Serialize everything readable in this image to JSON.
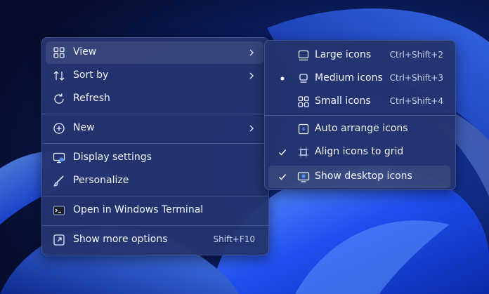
{
  "context_menu": {
    "items": [
      {
        "label": "View",
        "icon": "view-grid-icon",
        "submenu": true
      },
      {
        "label": "Sort by",
        "icon": "sort-icon",
        "submenu": true
      },
      {
        "label": "Refresh",
        "icon": "refresh-icon"
      },
      {
        "label": "New",
        "icon": "new-plus-icon",
        "submenu": true
      },
      {
        "label": "Display settings",
        "icon": "display-settings-icon"
      },
      {
        "label": "Personalize",
        "icon": "personalize-brush-icon"
      },
      {
        "label": "Open in Windows Terminal",
        "icon": "terminal-icon"
      },
      {
        "label": "Show more options",
        "icon": "show-more-options-icon",
        "shortcut": "Shift+F10"
      }
    ]
  },
  "view_submenu": {
    "items": [
      {
        "label": "Large icons",
        "icon": "large-icons-icon",
        "shortcut": "Ctrl+Shift+2",
        "selected": false
      },
      {
        "label": "Medium icons",
        "icon": "medium-icons-icon",
        "shortcut": "Ctrl+Shift+3",
        "selected": true
      },
      {
        "label": "Small icons",
        "icon": "small-icons-icon",
        "shortcut": "Ctrl+Shift+4",
        "selected": false
      },
      {
        "label": "Auto arrange icons",
        "icon": "auto-arrange-icon",
        "checked": false
      },
      {
        "label": "Align icons to grid",
        "icon": "align-to-grid-icon",
        "checked": true
      },
      {
        "label": "Show desktop icons",
        "icon": "show-desktop-icons-icon",
        "checked": true
      }
    ]
  },
  "colors": {
    "menu_background": "#24346e",
    "wallpaper_dark": "#07133a",
    "wallpaper_bloom": "#1f4ef0",
    "icon_accent": "#5b8cff"
  }
}
